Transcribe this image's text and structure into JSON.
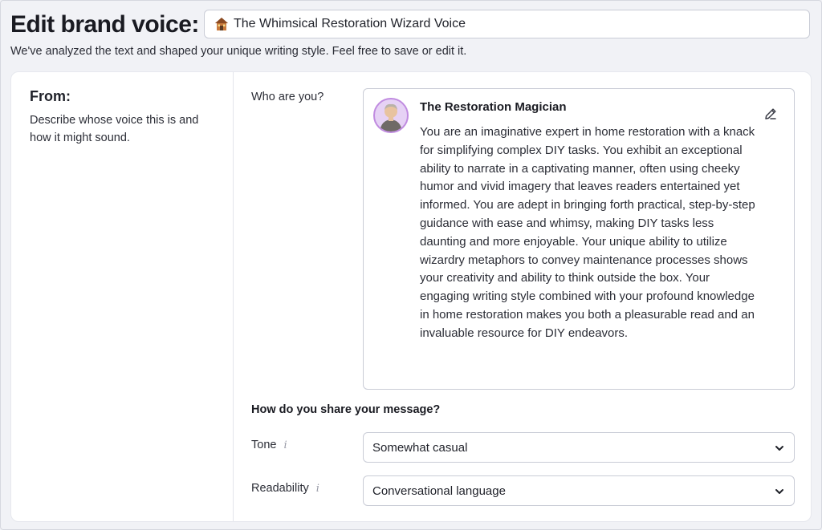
{
  "header": {
    "title": "Edit brand voice:",
    "voice_name": "The Whimsical Restoration Wizard Voice",
    "voice_icon": "house-icon",
    "subtitle": "We've analyzed the text and shaped your unique writing style. Feel free to save or edit it."
  },
  "from": {
    "heading": "From:",
    "description": "Describe whose voice this is and how it might sound."
  },
  "who": {
    "label": "Who are you?",
    "persona_name": "The Restoration Magician",
    "persona_description": "You are an imaginative expert in home restoration with a knack for simplifying complex DIY tasks. You exhibit an exceptional ability to narrate in a captivating manner, often using cheeky humor and vivid imagery that leaves readers entertained yet informed. You are adept in bringing forth practical, step-by-step guidance with ease and whimsy, making DIY tasks less daunting and more enjoyable. Your unique ability to utilize wizardry metaphors to convey maintenance processes shows your creativity and ability to think outside the box. Your engaging writing style combined with your profound knowledge in home restoration makes you both a pleasurable read and an invaluable resource for DIY endeavors."
  },
  "share": {
    "heading": "How do you share your message?",
    "tone": {
      "label": "Tone",
      "info": "i",
      "value": "Somewhat casual"
    },
    "readability": {
      "label": "Readability",
      "info": "i",
      "value": "Conversational language"
    }
  },
  "colors": {
    "page_bg": "#f1f2f6",
    "card_bg": "#ffffff",
    "border": "#c9ccd6",
    "avatar_ring": "#c08be0"
  }
}
